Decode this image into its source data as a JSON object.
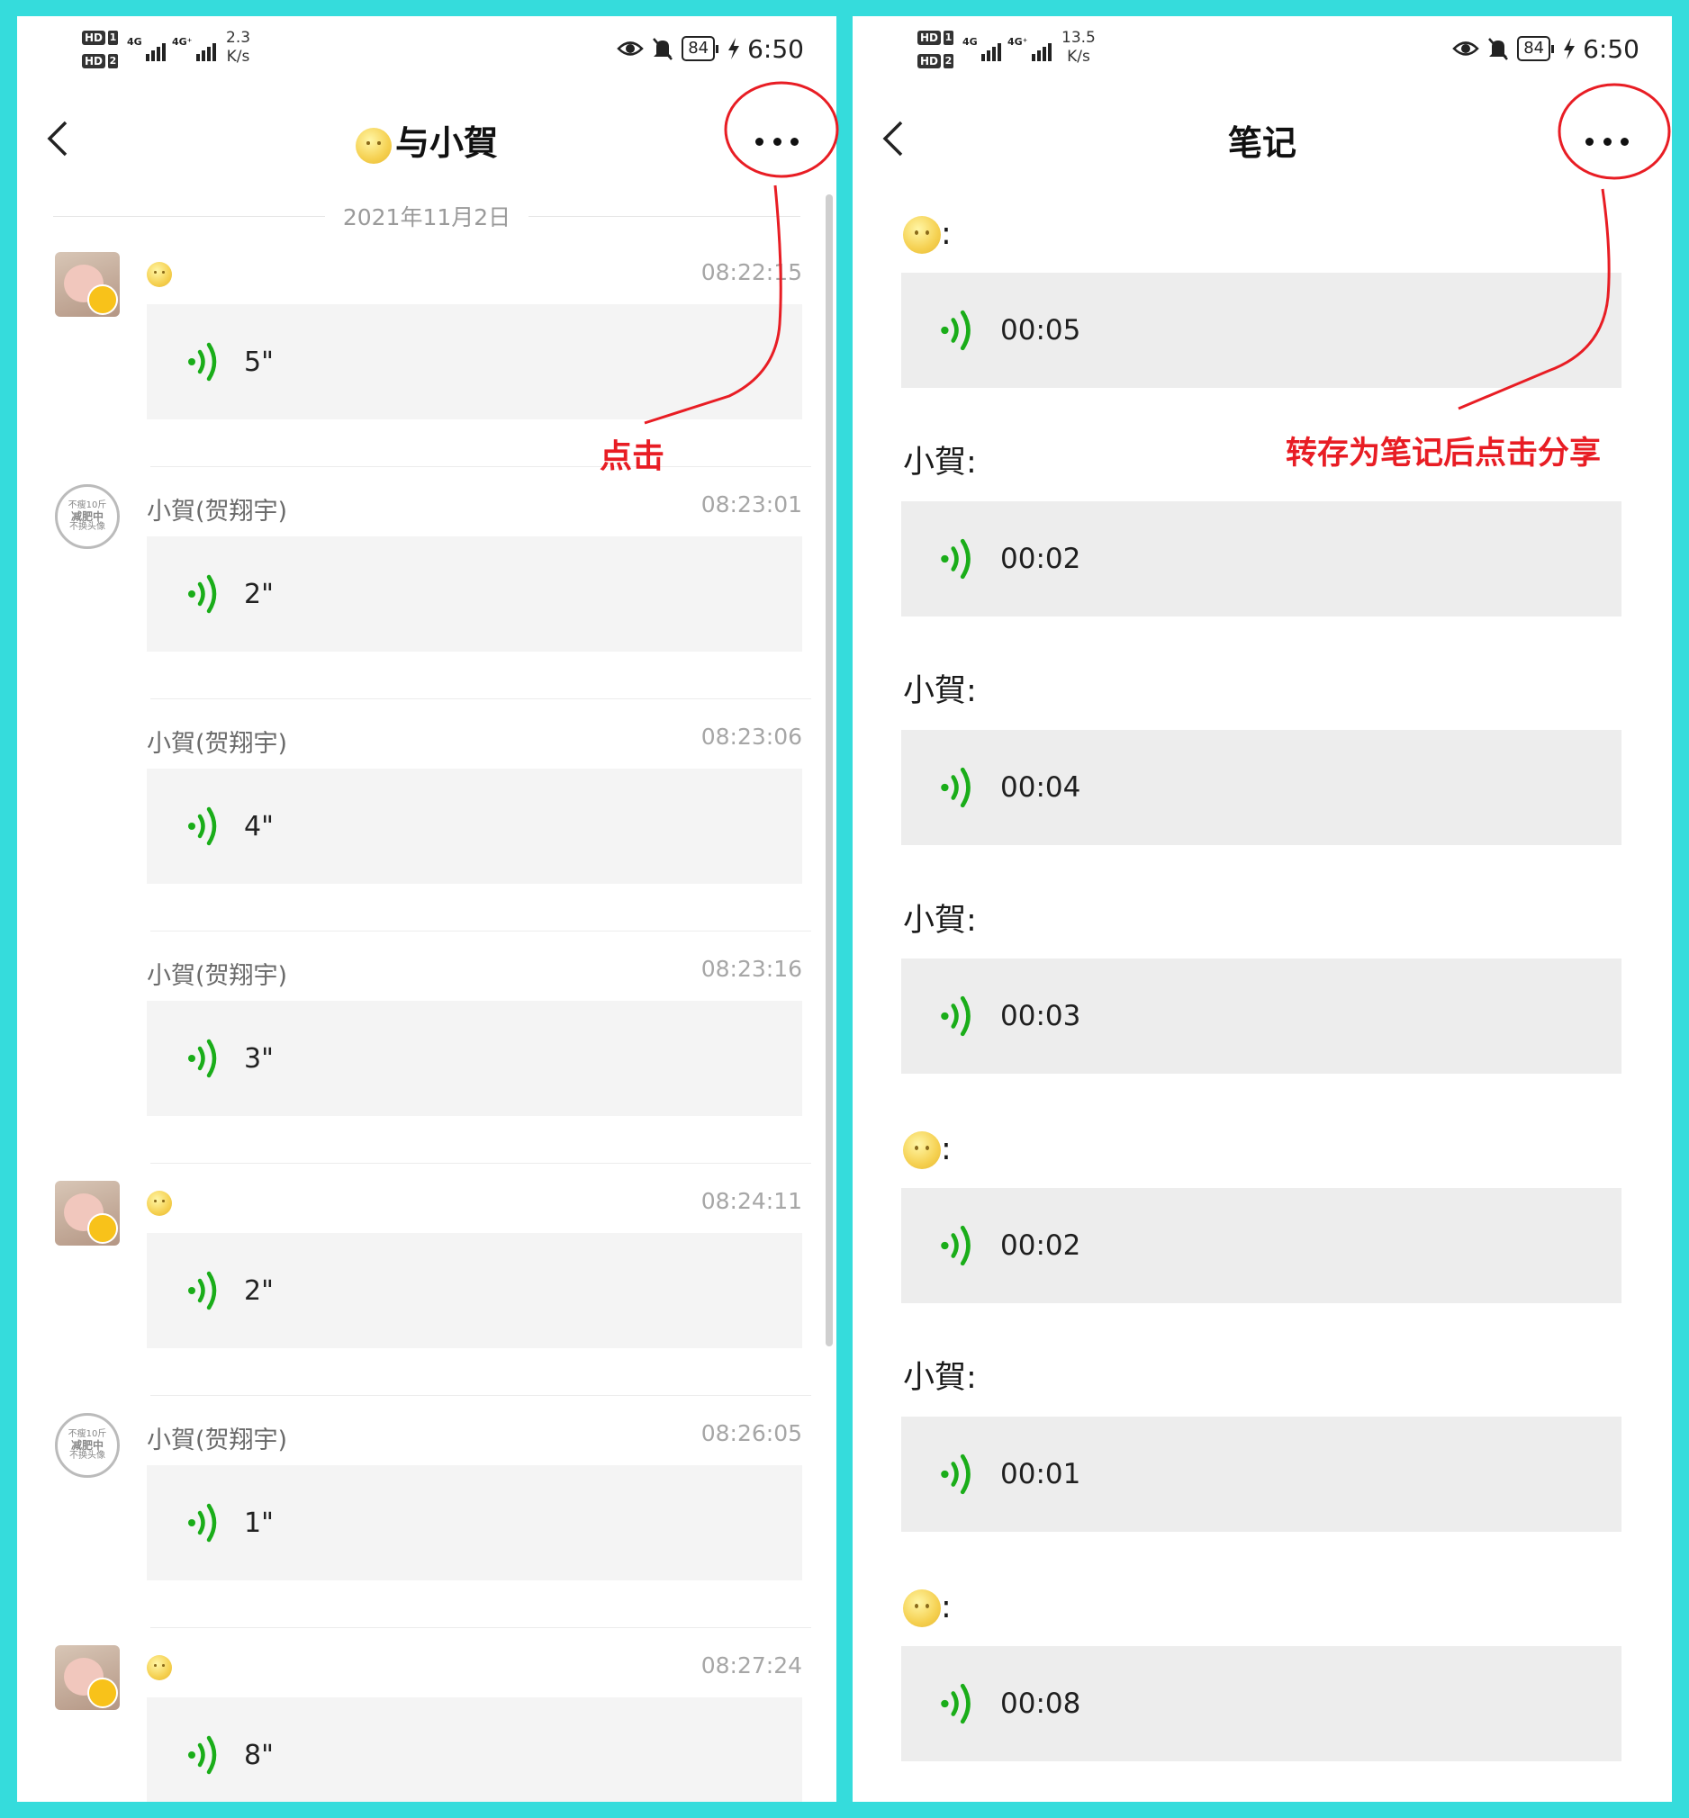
{
  "status_left": {
    "hd1": "HD",
    "hd1_num": "1",
    "hd2": "HD",
    "hd2_num": "2",
    "net1": "4G",
    "net2": "4G⁺",
    "speed_value": "2.3",
    "speed_unit": "K/s",
    "battery": "84",
    "time": "6:50"
  },
  "status_right": {
    "hd1": "HD",
    "hd1_num": "1",
    "hd2": "HD",
    "hd2_num": "2",
    "net1": "4G",
    "net2": "4G⁺",
    "speed_value": "13.5",
    "speed_unit": "K/s",
    "battery": "84",
    "time": "6:50"
  },
  "chat": {
    "title": "与小賀",
    "date": "2021年11月2日",
    "messages": [
      {
        "sender": "",
        "time": "08:22:15",
        "duration": "5\""
      },
      {
        "sender": "小賀(贺翔宇)",
        "time": "08:23:01",
        "duration": "2\""
      },
      {
        "sender": "小賀(贺翔宇)",
        "time": "08:23:06",
        "duration": "4\""
      },
      {
        "sender": "小賀(贺翔宇)",
        "time": "08:23:16",
        "duration": "3\""
      },
      {
        "sender": "",
        "time": "08:24:11",
        "duration": "2\""
      },
      {
        "sender": "小賀(贺翔宇)",
        "time": "08:26:05",
        "duration": "1\""
      },
      {
        "sender": "",
        "time": "08:27:24",
        "duration": "8\""
      }
    ]
  },
  "note": {
    "title": "笔记",
    "entries": [
      {
        "speaker": "",
        "duration": "00:05"
      },
      {
        "speaker": "小賀",
        "duration": "00:02"
      },
      {
        "speaker": "小賀",
        "duration": "00:04"
      },
      {
        "speaker": "小賀",
        "duration": "00:03"
      },
      {
        "speaker": "",
        "duration": "00:02"
      },
      {
        "speaker": "小賀",
        "duration": "00:01"
      },
      {
        "speaker": "",
        "duration": "00:08"
      }
    ]
  },
  "annotations": {
    "left": "点击",
    "right": "转存为笔记后点击分享"
  },
  "stamp_text": [
    "不瘦10斤",
    "减肥中",
    "不换头像"
  ],
  "colors": {
    "accent_green": "#1aad19",
    "annotation_red": "#e81d24",
    "frame": "#35dcdc"
  }
}
